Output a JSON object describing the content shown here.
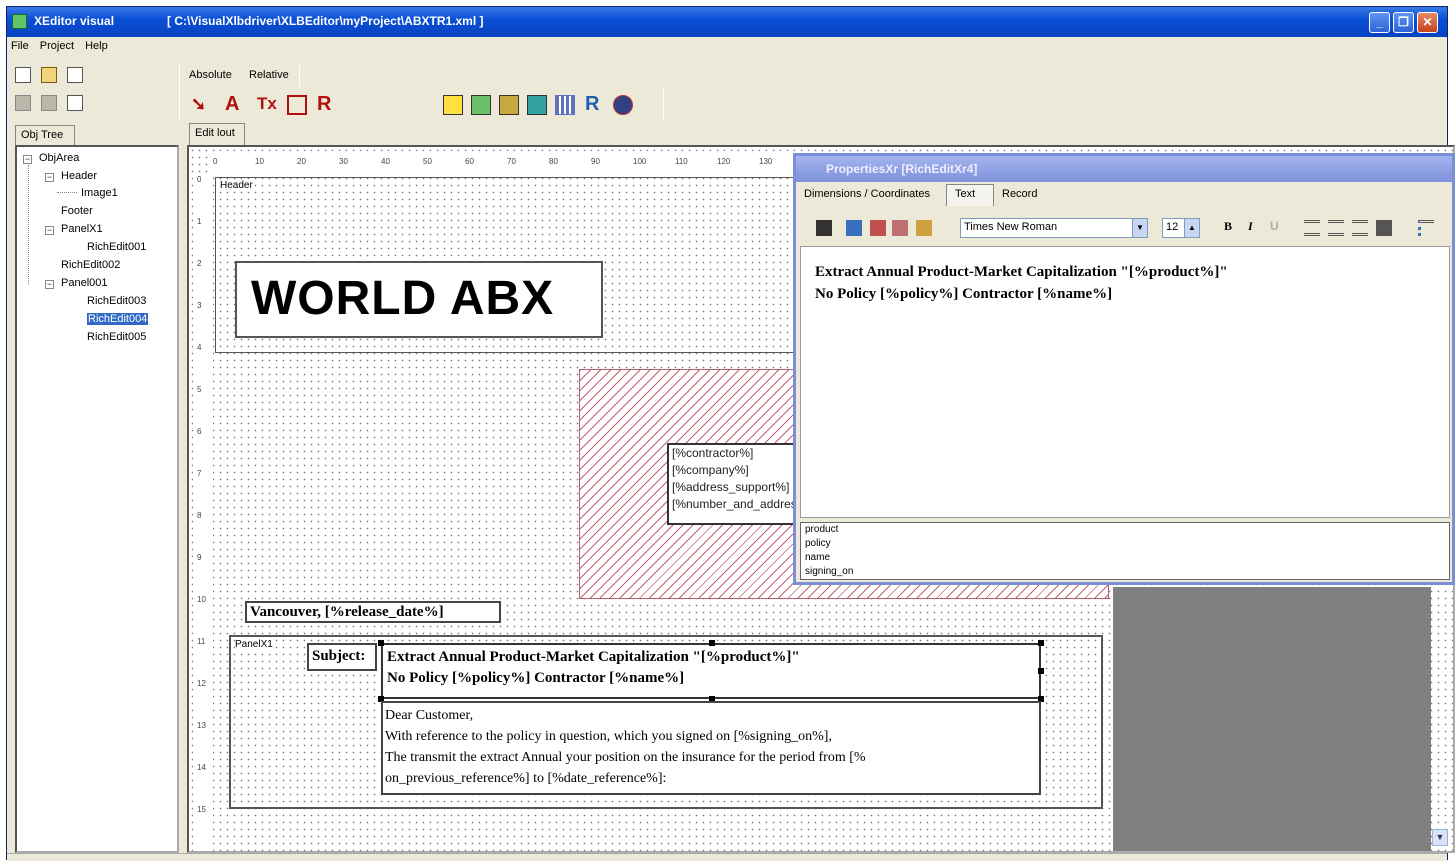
{
  "window": {
    "app_title": "XEditor visual",
    "file_path": "[ C:\\VisualXlbdriver\\XLBEditor\\myProject\\ABXTR1.xml ]",
    "min_glyph": "_",
    "max_glyph": "❐",
    "close_glyph": "✕"
  },
  "menu": [
    "File",
    "Project",
    "Help"
  ],
  "mode_tabs": {
    "absolute": "Absolute",
    "relative": "Relative"
  },
  "tools": {
    "text": "A",
    "text_x": "Tx",
    "box": "",
    "rich": "R"
  },
  "left_tab": "Obj Tree",
  "edit_tab": "Edit lout",
  "tree": {
    "root": "ObjArea",
    "header": "Header",
    "image1": "Image1",
    "footer": "Footer",
    "panel1": "PanelX1",
    "rich1": "RichEdit001",
    "rich2": "RichEdit002",
    "panel2": "Panel001",
    "rich3": "RichEdit003",
    "rich4": "RichEdit004",
    "rich5": "RichEdit005"
  },
  "ruler": {
    "top": [
      "0",
      "10",
      "20",
      "30",
      "40",
      "50",
      "60",
      "70",
      "80",
      "90",
      "100",
      "110",
      "120",
      "130"
    ],
    "left": [
      "0",
      "1",
      "2",
      "3",
      "4",
      "5",
      "6",
      "7",
      "8",
      "9",
      "10",
      "11",
      "12",
      "13",
      "14",
      "15"
    ]
  },
  "canvas": {
    "header_band": "Header",
    "logo_text": "WORLD ABX",
    "fields": [
      "[%contractor%]",
      "[%company%]",
      "[%address_support%]",
      "[%number_and_address%]"
    ],
    "city_line": "Vancouver, [%release_date%]",
    "panel_label": "PanelX1",
    "subject_label": "Subject:",
    "subject_line1": "Extract Annual Product-Market Capitalization \"[%product%]\"",
    "subject_line2": "No Policy [%policy%] Contractor [%name%]",
    "body_lines": [
      "Dear Customer,",
      "With reference to the policy in question, which you signed on [%signing_on%],",
      "The transmit the extract Annual your position on the insurance for the period from [%",
      "on_previous_reference%] to [%date_reference%]:"
    ]
  },
  "properties": {
    "title": "PropertiesXr [RichEditXr4]",
    "tabs": [
      "Dimensions / Coordinates",
      "Text",
      "Record"
    ],
    "font": "Times New Roman",
    "size": "12",
    "bold": "B",
    "italic": "I",
    "underline": "U",
    "content_line1": "Extract Annual Product-Market Capitalization \"[%product%]\"",
    "content_line2": "No Policy [%policy%] Contractor [%name%]",
    "variables": [
      "product",
      "policy",
      "name",
      "signing_on"
    ]
  },
  "colors": {
    "title_blue": "#0a4fd6",
    "selection": "#316ac5",
    "hatch": "#c06070",
    "tool_red": "#b01010"
  }
}
